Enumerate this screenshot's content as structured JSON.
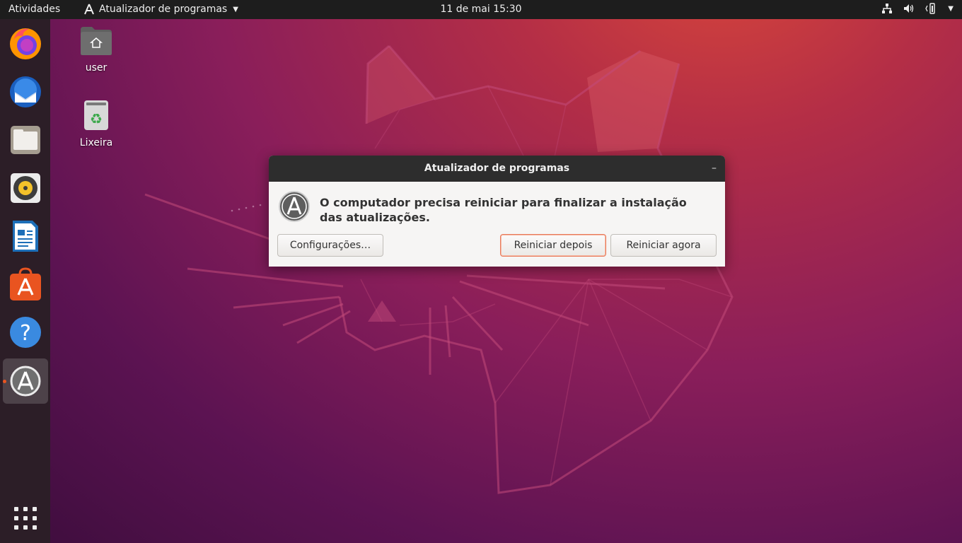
{
  "topbar": {
    "activities": "Atividades",
    "app_name": "Atualizador de programas",
    "clock": "11 de mai  15:30"
  },
  "dock": {
    "items": [
      "firefox",
      "thunderbird",
      "files",
      "rhythmbox",
      "libreoffice-writer",
      "ubuntu-software",
      "help",
      "software-updater"
    ],
    "active": "software-updater",
    "show_apps": "show-applications"
  },
  "desktop": {
    "icons": [
      {
        "label": "user"
      },
      {
        "label": "Lixeira"
      }
    ]
  },
  "dialog": {
    "title": "Atualizador de programas",
    "minimize": "–",
    "message": "O computador precisa reiniciar para finalizar a instalação das atualizações.",
    "buttons": {
      "settings": "Configurações…",
      "restart_later": "Reiniciar depois",
      "restart_now": "Reiniciar agora"
    }
  },
  "colors": {
    "accent": "#e95420",
    "topbar": "#1d1d1d",
    "dock": "#2c1e27",
    "dialog_bg": "#f6f5f4"
  }
}
